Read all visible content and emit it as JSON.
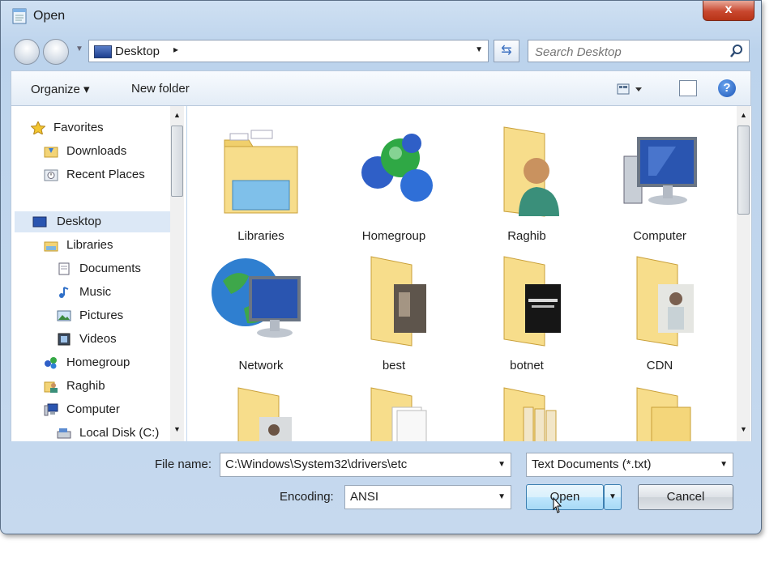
{
  "window": {
    "title": "Open",
    "close_label": "x"
  },
  "navbar": {
    "address_location": "Desktop",
    "address_separator": "▸",
    "search_placeholder": "Search Desktop"
  },
  "toolbar": {
    "organize_label": "Organize ▾",
    "new_folder_label": "New folder",
    "help_label": "?"
  },
  "sidebar": {
    "favorites": "Favorites",
    "downloads": "Downloads",
    "recent_places": "Recent Places",
    "desktop": "Desktop",
    "libraries": "Libraries",
    "documents": "Documents",
    "music": "Music",
    "pictures": "Pictures",
    "videos": "Videos",
    "homegroup": "Homegroup",
    "raghib": "Raghib",
    "computer": "Computer",
    "local_disk": "Local Disk (C:)"
  },
  "items": [
    {
      "label": "Libraries",
      "icon": "libraries-icon"
    },
    {
      "label": "Homegroup",
      "icon": "homegroup-icon"
    },
    {
      "label": "Raghib",
      "icon": "user-folder-icon"
    },
    {
      "label": "Computer",
      "icon": "computer-icon"
    },
    {
      "label": "Network",
      "icon": "network-icon"
    },
    {
      "label": "best",
      "icon": "folder-icon"
    },
    {
      "label": "botnet",
      "icon": "folder-icon"
    },
    {
      "label": "CDN",
      "icon": "folder-icon"
    },
    {
      "label": "",
      "icon": "folder-icon"
    },
    {
      "label": "",
      "icon": "folder-icon"
    },
    {
      "label": "",
      "icon": "folder-icon"
    },
    {
      "label": "",
      "icon": "folder-icon"
    }
  ],
  "bottom": {
    "file_name_label": "File name:",
    "file_name_value": "C:\\Windows\\System32\\drivers\\etc",
    "file_type_value": "Text Documents (*.txt)",
    "encoding_label": "Encoding:",
    "encoding_value": "ANSI",
    "open_label": "Open",
    "cancel_label": "Cancel"
  },
  "colors": {
    "folder": "#f5d97a",
    "selection": "#dce8f6",
    "accent": "#3c7fb1"
  }
}
